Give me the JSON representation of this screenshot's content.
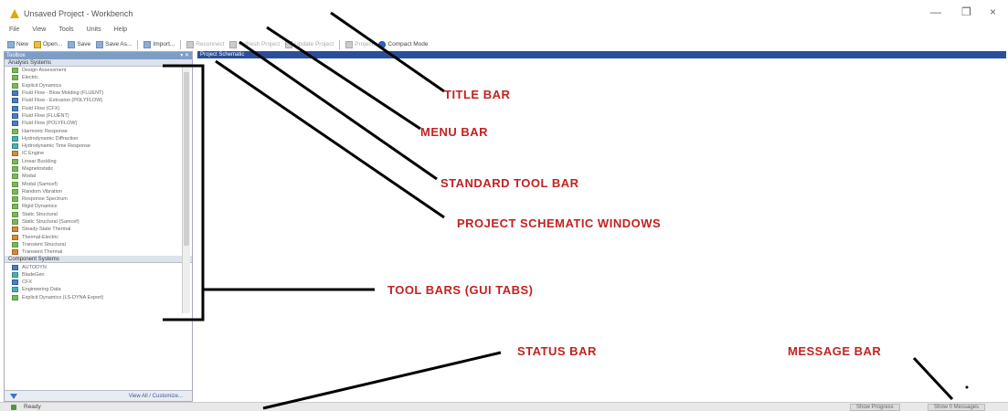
{
  "window": {
    "title": "Unsaved Project - Workbench",
    "controls": {
      "minimize": "—",
      "restore": "❐",
      "close": "×"
    }
  },
  "menu": [
    "File",
    "View",
    "Tools",
    "Units",
    "Help"
  ],
  "toolbar": {
    "new": "New",
    "open": "Open...",
    "save": "Save",
    "save_as": "Save As...",
    "import": "Import...",
    "reconnect": "Reconnect",
    "refresh": "Refresh Project",
    "update": "Update Project",
    "project": "Project",
    "compact": "Compact Mode"
  },
  "toolbox": {
    "title": "Toolbox",
    "analysis_header": "Analysis Systems",
    "analysis_systems": [
      "Design Assessment",
      "Electric",
      "Explicit Dynamics",
      "Fluid Flow - Blow Molding (FLUENT)",
      "Fluid Flow - Extrusion (POLYFLOW)",
      "Fluid Flow (CFX)",
      "Fluid Flow (FLUENT)",
      "Fluid Flow (POLYFLOW)",
      "Harmonic Response",
      "Hydrodynamic Diffraction",
      "Hydrodynamic Time Response",
      "IC Engine",
      "Linear Buckling",
      "Magnetostatic",
      "Modal",
      "Modal (Samcef)",
      "Random Vibration",
      "Response Spectrum",
      "Rigid Dynamics",
      "Static Structural",
      "Static Structural (Samcef)",
      "Steady-State Thermal",
      "Thermal-Electric",
      "Transient Structural",
      "Transient Thermal"
    ],
    "component_header": "Component Systems",
    "component_systems": [
      "AUTODYN",
      "BladeGen",
      "CFX",
      "Engineering Data",
      "Explicit Dynamics (LS-DYNA Export)"
    ],
    "view_all": "View All / Customize..."
  },
  "schematic": {
    "title": "Project Schematic"
  },
  "status": {
    "text": "Ready",
    "show_progress": "Show Progress",
    "show_messages": "Show 0 Messages"
  },
  "annotations": {
    "title_bar": "TITLE BAR",
    "menu_bar": "MENU BAR",
    "standard_tool_bar": "STANDARD TOOL BAR",
    "project_schematic": "PROJECT SCHEMATIC WINDOWS",
    "tool_bars": "TOOL BARS (GUI TABS)",
    "status_bar": "STATUS BAR",
    "message_bar": "MESSAGE BAR"
  },
  "colors": {
    "annotation_text": "#c22222",
    "schematic_header": "#2a4f9a",
    "toolbox_header": "#7f9dc4"
  }
}
